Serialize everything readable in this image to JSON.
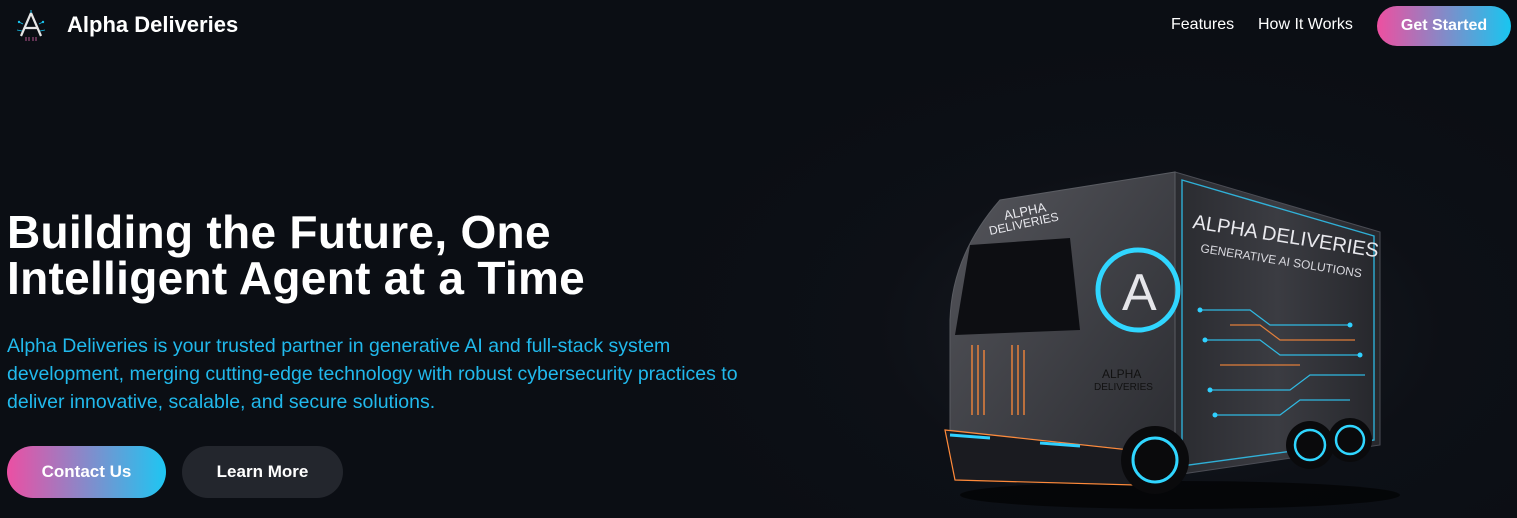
{
  "nav": {
    "brand": "Alpha Deliveries",
    "links": [
      {
        "label": "Features"
      },
      {
        "label": "How It Works"
      }
    ],
    "cta_label": "Get Started",
    "logo_icon": "alpha-circuit-logo-icon"
  },
  "hero": {
    "title_line1": "Building the Future, One",
    "title_line2": "Intelligent Agent at a Time",
    "description": "Alpha Deliveries is your trusted partner in generative AI and full-stack system development, merging cutting-edge technology with robust cybersecurity practices to deliver innovative, scalable, and secure solutions.",
    "primary_button": "Contact Us",
    "secondary_button": "Learn More"
  },
  "truck_image": {
    "cab_text_line1": "ALPHA",
    "cab_text_line2": "DELIVERIES",
    "emblem_letter": "A",
    "emblem_caption_line1": "ALPHA",
    "emblem_caption_line2": "DELIVERIES",
    "side_title": "ALPHA DELIVERIES",
    "side_subtitle": "GENERATIVE AI SOLUTIONS"
  },
  "colors": {
    "background": "#0b0e14",
    "accent_pink": "#ee4fa0",
    "accent_cyan": "#18c6f0",
    "description_text": "#21b9ec",
    "secondary_button": "#23262d"
  }
}
